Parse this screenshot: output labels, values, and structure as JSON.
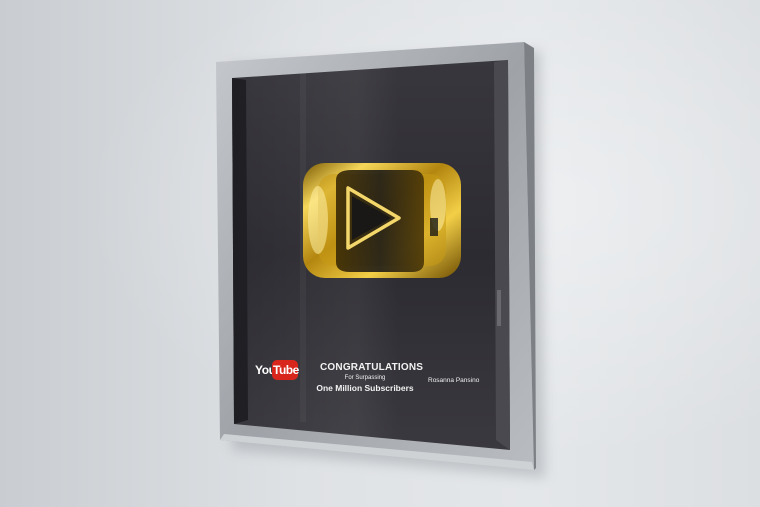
{
  "award": {
    "logo_word_left": "You",
    "logo_word_right": "Tube",
    "headline": "CONGRATULATIONS",
    "subline": "For Surpassing",
    "milestone": "One Million Subscribers",
    "recipient": "Rosanna Pansino"
  },
  "colors": {
    "wall": "#dfe2e5",
    "frame": "#a9adb1",
    "backing": "#2b2a30",
    "gold": "#d4a51c",
    "logo_red": "#d8261c"
  },
  "icons": {
    "play_button": "play-button-icon",
    "brand": "youtube-logo"
  }
}
